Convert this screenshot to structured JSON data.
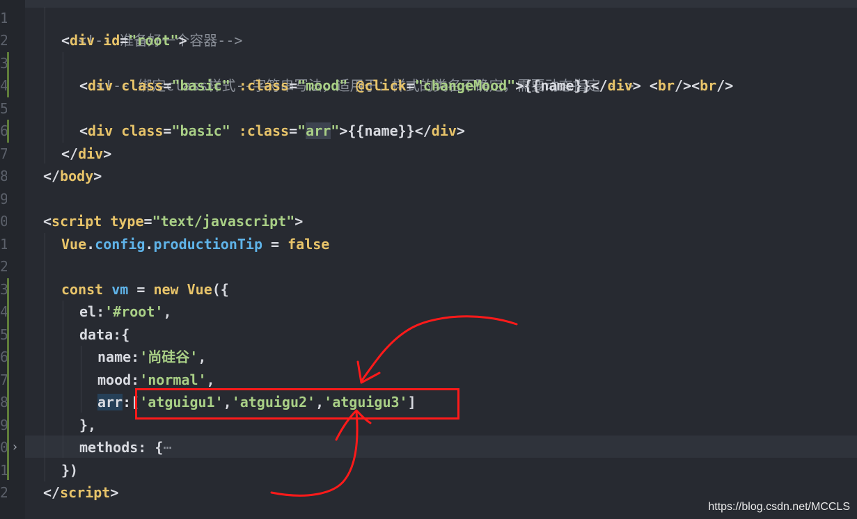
{
  "editor": {
    "line_numbers": [
      "1",
      "2",
      "3",
      "4",
      "5",
      "6",
      "7",
      "8",
      "9",
      "0",
      "1",
      "2",
      "3",
      "4",
      "5",
      "6",
      "7",
      "8",
      "9",
      "0",
      "1",
      "2"
    ],
    "lines": {
      "l1_comment": "<!-- 准备好一个容器-->",
      "l2_open": "<",
      "l2_tag": "div",
      "l2_attr": " id",
      "l2_eq": "=",
      "l2_val": "\"root\"",
      "l2_close": ">",
      "l3_comment": "<!-- 绑定class样式--字符串写法，适用于：样式的类名不确定，需要动态指定 -->",
      "l4_a": "<",
      "l4_tag": "div",
      "l4_attr1": " class",
      "l4_eq1": "=",
      "l4_val1": "\"basic\"",
      "l4_attr2": " :class",
      "l4_eq2": "=",
      "l4_val2": "\"mood\"",
      "l4_attr3": " @click",
      "l4_eq3": "=",
      "l4_val3": "\"changeMood\"",
      "l4_b": ">{{name}}</",
      "l4_tag2": "div",
      "l4_c": "> <",
      "l4_tag3": "br",
      "l4_d": "/><",
      "l4_tag4": "br",
      "l4_e": "/>",
      "l6_a": "<",
      "l6_tag": "div",
      "l6_attr1": " class",
      "l6_eq1": "=",
      "l6_val1": "\"basic\"",
      "l6_attr2": " :class",
      "l6_eq2": "=",
      "l6_q1": "\"",
      "l6_arr": "arr",
      "l6_q2": "\"",
      "l6_b": ">{{name}}</",
      "l6_tag2": "div",
      "l6_c": ">",
      "l7_a": "</",
      "l7_tag": "div",
      "l7_b": ">",
      "l8_a": "</",
      "l8_tag": "body",
      "l8_b": ">",
      "l10_a": "<",
      "l10_tag": "script",
      "l10_attr": " type",
      "l10_eq": "=",
      "l10_val": "\"text/javascript\"",
      "l10_b": ">",
      "l11_vue": "Vue",
      "l11_dot1": ".",
      "l11_config": "config",
      "l11_dot2": ".",
      "l11_prop": "productionTip",
      "l11_eq": " = ",
      "l11_false": "false",
      "l13_const": "const",
      "l13_vm": " vm",
      "l13_eq": " = ",
      "l13_new": "new",
      "l13_vue": " Vue",
      "l13_b": "({",
      "l14_key": "el",
      "l14_colon": ":",
      "l14_val": "'#root'",
      "l14_comma": ",",
      "l15_key": "data",
      "l15_b": ":{",
      "l16_key": "name",
      "l16_colon": ":",
      "l16_val": "'尚硅谷'",
      "l16_comma": ",",
      "l17_key": "mood",
      "l17_colon": ":",
      "l17_val": "'normal'",
      "l17_comma": ",",
      "l18_key": "arr",
      "l18_colon": ":",
      "l18_b1": "[",
      "l18_v1": "'atguigu1'",
      "l18_c1": ",",
      "l18_v2": "'atguigu2'",
      "l18_c2": ",",
      "l18_v3": "'atguigu3'",
      "l18_b2": "]",
      "l19": "},",
      "l20_key": "methods",
      "l20_b": ": {",
      "l20_ellipsis": "⋯",
      "l21": "})",
      "l22_a": "</",
      "l22_tag": "script",
      "l22_b": ">"
    }
  },
  "watermark": "https://blog.csdn.net/MCCLS",
  "colors": {
    "background": "#272a31",
    "tag": "#e8c46a",
    "string": "#a9cf86",
    "comment": "#8a8f98",
    "variable": "#5fb3e8",
    "annotation": "#ff1a1a"
  }
}
